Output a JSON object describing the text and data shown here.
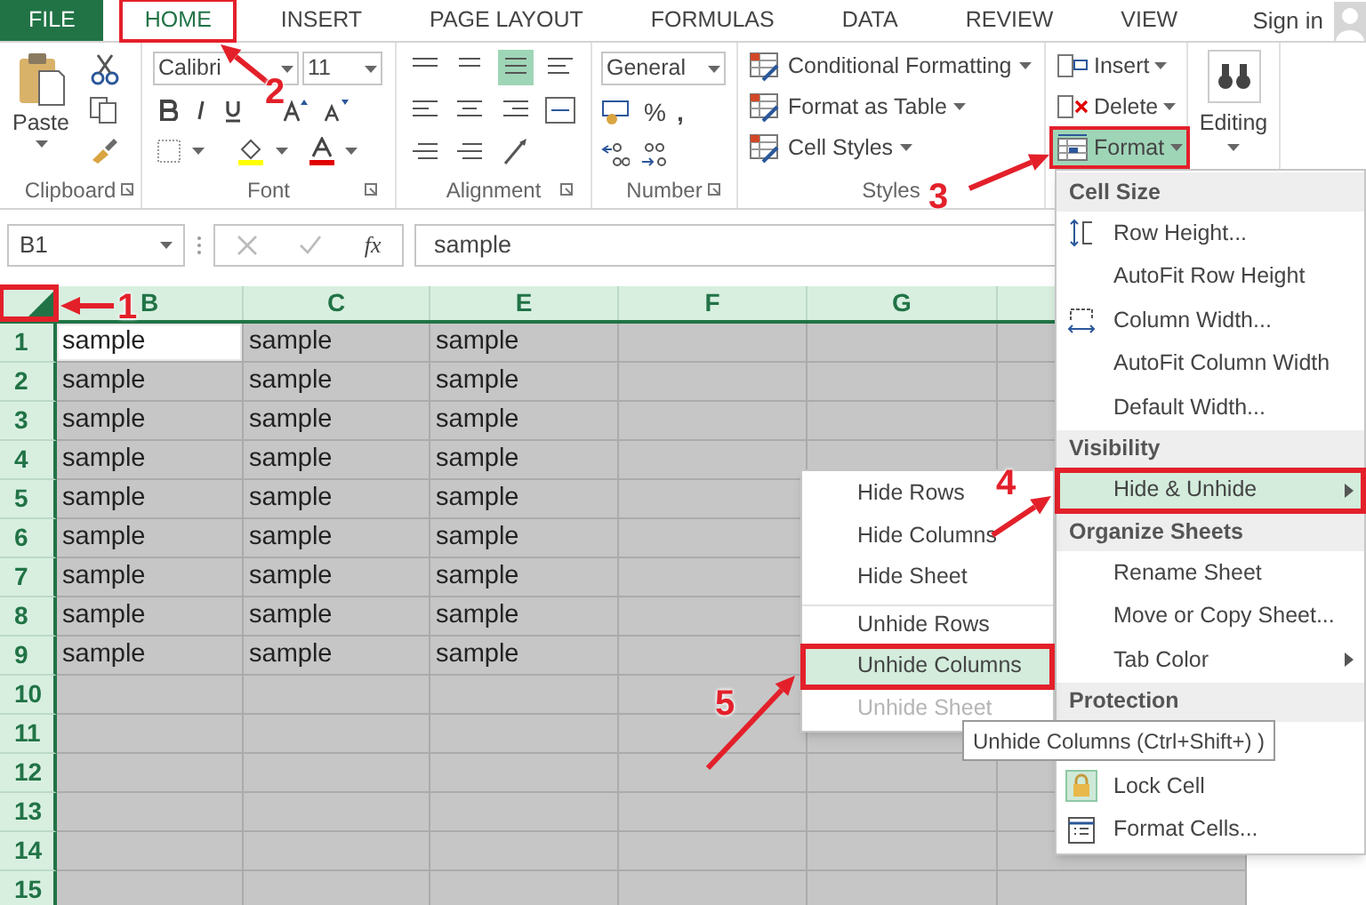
{
  "tabs": [
    {
      "label": "FILE",
      "kind": "file",
      "selected": false,
      "outlined": false
    },
    {
      "label": "HOME",
      "kind": "tab",
      "selected": true,
      "outlined": true
    },
    {
      "label": "INSERT",
      "kind": "tab",
      "selected": false,
      "outlined": false
    },
    {
      "label": "PAGE LAYOUT",
      "kind": "tab",
      "selected": false,
      "outlined": false
    },
    {
      "label": "FORMULAS",
      "kind": "tab",
      "selected": false,
      "outlined": false
    },
    {
      "label": "DATA",
      "kind": "tab",
      "selected": false,
      "outlined": false
    },
    {
      "label": "REVIEW",
      "kind": "tab",
      "selected": false,
      "outlined": false
    },
    {
      "label": "VIEW",
      "kind": "tab",
      "selected": false,
      "outlined": false
    }
  ],
  "sign_in": "Sign in",
  "ribbon": {
    "clipboard": {
      "paste": "Paste",
      "label": "Clipboard"
    },
    "font": {
      "name": "Calibri",
      "size": "11",
      "label": "Font"
    },
    "alignment": {
      "label": "Alignment"
    },
    "number": {
      "format": "General",
      "percent": "%",
      "comma": ",",
      "label": "Number"
    },
    "styles": {
      "items": [
        "Conditional Formatting",
        "Format as Table",
        "Cell Styles"
      ],
      "label": "Styles"
    },
    "cells": {
      "items": [
        {
          "label": "Insert",
          "kind": "insert",
          "selected": false,
          "outlined": false
        },
        {
          "label": "Delete",
          "kind": "delete",
          "selected": false,
          "outlined": false
        },
        {
          "label": "Format",
          "kind": "format",
          "selected": true,
          "outlined": true
        }
      ]
    },
    "editing": {
      "label": "Editing"
    }
  },
  "formula_bar": {
    "name_box": "B1",
    "function_label": "fx",
    "value": "sample"
  },
  "sheet": {
    "columns": [
      "B",
      "C",
      "E",
      "F",
      "G"
    ],
    "select_all": {
      "selected": true,
      "outlined": true
    },
    "rows": [
      {
        "header": "1",
        "cells": [
          {
            "text": "sample",
            "active": true
          },
          {
            "text": "sample",
            "active": false
          },
          {
            "text": "sample",
            "active": false
          }
        ]
      },
      {
        "header": "2",
        "cells": [
          {
            "text": "sample",
            "active": false
          },
          {
            "text": "sample",
            "active": false
          },
          {
            "text": "sample",
            "active": false
          }
        ]
      },
      {
        "header": "3",
        "cells": [
          {
            "text": "sample",
            "active": false
          },
          {
            "text": "sample",
            "active": false
          },
          {
            "text": "sample",
            "active": false
          }
        ]
      },
      {
        "header": "4",
        "cells": [
          {
            "text": "sample",
            "active": false
          },
          {
            "text": "sample",
            "active": false
          },
          {
            "text": "sample",
            "active": false
          }
        ]
      },
      {
        "header": "5",
        "cells": [
          {
            "text": "sample",
            "active": false
          },
          {
            "text": "sample",
            "active": false
          },
          {
            "text": "sample",
            "active": false
          }
        ]
      },
      {
        "header": "6",
        "cells": [
          {
            "text": "sample",
            "active": false
          },
          {
            "text": "sample",
            "active": false
          },
          {
            "text": "sample",
            "active": false
          }
        ]
      },
      {
        "header": "7",
        "cells": [
          {
            "text": "sample",
            "active": false
          },
          {
            "text": "sample",
            "active": false
          },
          {
            "text": "sample",
            "active": false
          }
        ]
      },
      {
        "header": "8",
        "cells": [
          {
            "text": "sample",
            "active": false
          },
          {
            "text": "sample",
            "active": false
          },
          {
            "text": "sample",
            "active": false
          }
        ]
      },
      {
        "header": "9",
        "cells": [
          {
            "text": "sample",
            "active": false
          },
          {
            "text": "sample",
            "active": false
          },
          {
            "text": "sample",
            "active": false
          }
        ]
      },
      {
        "header": "10",
        "cells": []
      },
      {
        "header": "11",
        "cells": []
      },
      {
        "header": "12",
        "cells": []
      },
      {
        "header": "13",
        "cells": []
      },
      {
        "header": "14",
        "cells": []
      },
      {
        "header": "15",
        "cells": []
      }
    ]
  },
  "format_menu": {
    "sections": [
      {
        "header": "Cell Size",
        "items": [
          {
            "label": "Row Height...",
            "kind": "row_height",
            "selected": false,
            "outlined": false,
            "has_submenu": false
          },
          {
            "label": "AutoFit Row Height",
            "kind": "plain",
            "selected": false,
            "outlined": false,
            "has_submenu": false
          },
          {
            "label": "Column Width...",
            "kind": "column_width",
            "selected": false,
            "outlined": false,
            "has_submenu": false
          },
          {
            "label": "AutoFit Column Width",
            "kind": "plain",
            "selected": false,
            "outlined": false,
            "has_submenu": false
          },
          {
            "label": "Default Width...",
            "kind": "plain",
            "selected": false,
            "outlined": false,
            "has_submenu": false
          }
        ]
      },
      {
        "header": "Visibility",
        "items": [
          {
            "label": "Hide & Unhide",
            "kind": "plain",
            "selected": true,
            "outlined": true,
            "has_submenu": true
          }
        ]
      },
      {
        "header": "Organize Sheets",
        "items": [
          {
            "label": "Rename Sheet",
            "kind": "plain",
            "selected": false,
            "outlined": false,
            "has_submenu": false
          },
          {
            "label": "Move or Copy Sheet...",
            "kind": "plain",
            "selected": false,
            "outlined": false,
            "has_submenu": false
          },
          {
            "label": "Tab Color",
            "kind": "plain",
            "selected": false,
            "outlined": false,
            "has_submenu": true
          }
        ]
      },
      {
        "header": "Protection",
        "items": [
          {
            "kind": "covered"
          },
          {
            "label": "Lock Cell",
            "kind": "lock",
            "selected": false,
            "outlined": false,
            "has_submenu": false
          },
          {
            "label": "Format Cells...",
            "kind": "format_cells",
            "selected": false,
            "outlined": false,
            "has_submenu": false
          }
        ]
      }
    ]
  },
  "hide_unhide_menu": {
    "items": [
      {
        "label": "Hide Rows",
        "selected": false,
        "outlined": false,
        "disabled": false,
        "divider_before": false
      },
      {
        "label": "Hide Columns",
        "selected": false,
        "outlined": false,
        "disabled": false,
        "divider_before": false
      },
      {
        "label": "Hide Sheet",
        "selected": false,
        "outlined": false,
        "disabled": false,
        "divider_before": false
      },
      {
        "label": "Unhide Rows",
        "selected": false,
        "outlined": false,
        "disabled": false,
        "divider_before": true
      },
      {
        "label": "Unhide Columns",
        "selected": true,
        "outlined": true,
        "disabled": false,
        "divider_before": false
      },
      {
        "label": "Unhide Sheet",
        "selected": false,
        "outlined": false,
        "disabled": true,
        "divider_before": false
      }
    ]
  },
  "tooltip": "Unhide Columns (Ctrl+Shift+) )",
  "annotations": [
    {
      "label": "1"
    },
    {
      "label": "2"
    },
    {
      "label": "3"
    },
    {
      "label": "4"
    },
    {
      "label": "5"
    }
  ]
}
